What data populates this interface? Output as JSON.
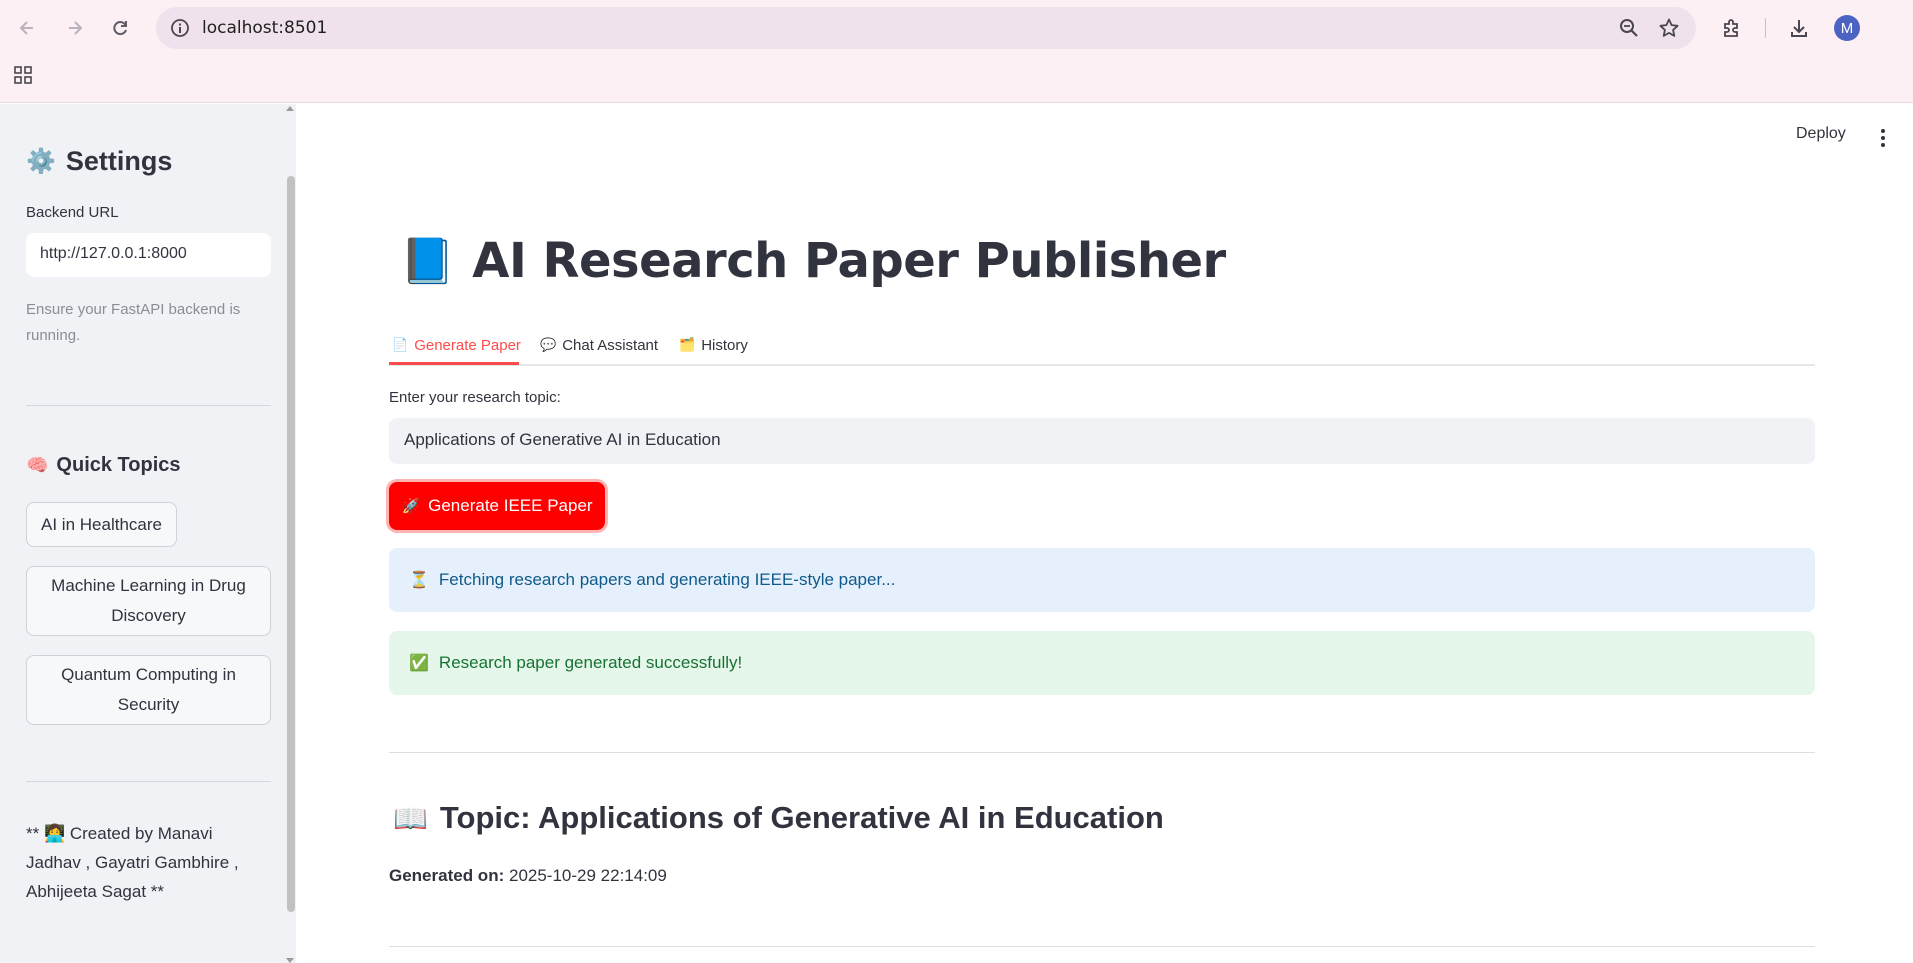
{
  "browser": {
    "url": "localhost:8501",
    "avatar_letter": "M"
  },
  "sidebar": {
    "title_icon": "⚙️",
    "title": "Settings",
    "backend_label": "Backend URL",
    "backend_value": "http://127.0.0.1:8000",
    "backend_caption": "Ensure your FastAPI backend is running.",
    "quick_icon": "🧠",
    "quick_title": "Quick Topics",
    "topics": [
      "AI in Healthcare",
      "Machine Learning in Drug Discovery",
      "Quantum Computing in Security"
    ],
    "footer": "** 👩‍💻 Created by Manavi Jadhav , Gayatri Gambhire , Abhijeeta Sagat **"
  },
  "header": {
    "deploy_label": "Deploy"
  },
  "main": {
    "title_icon": "📘",
    "title": "AI Research Paper Publisher",
    "tabs": [
      {
        "icon": "📄",
        "label": "Generate Paper"
      },
      {
        "icon": "💬",
        "label": "Chat Assistant"
      },
      {
        "icon": "🗂️",
        "label": "History"
      }
    ],
    "topic_label": "Enter your research topic:",
    "topic_value": "Applications of Generative AI in Education",
    "generate_icon": "🚀",
    "generate_label": "Generate IEEE Paper",
    "info_icon": "⏳",
    "info_text": "Fetching research papers and generating IEEE-style paper...",
    "success_icon": "✅",
    "success_text": "Research paper generated successfully!",
    "section_icon": "📖",
    "section_title": "Topic: Applications of Generative AI in Education",
    "generated_on_label": "Generated on:",
    "generated_on_value": "2025-10-29 22:14:09"
  },
  "colors": {
    "accent": "#ff4b4b",
    "primary_button": "#ff0000",
    "info_bg": "#e6f0fd",
    "success_bg": "#e5f7ea",
    "sidebar_bg": "#f0f2f6"
  }
}
